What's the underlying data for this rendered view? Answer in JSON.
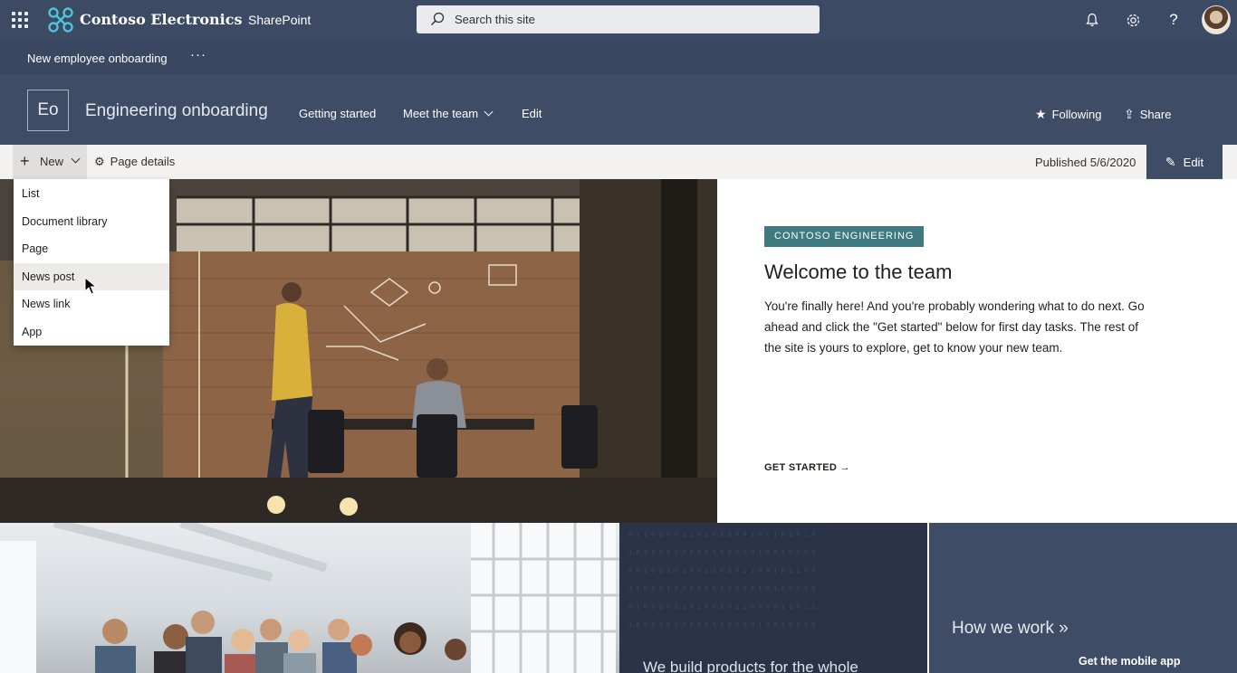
{
  "suite": {
    "brand": "Contoso Electronics",
    "product": "SharePoint",
    "search_placeholder": "Search this site"
  },
  "hub": {
    "title": "New employee onboarding",
    "more": "···"
  },
  "site": {
    "logo_initials": "Eo",
    "title": "Engineering onboarding",
    "nav": [
      {
        "label": "Getting started"
      },
      {
        "label": "Meet the team"
      },
      {
        "label": "Edit"
      }
    ],
    "following_label": "Following",
    "share_label": "Share"
  },
  "command": {
    "new_label": "New",
    "page_details_label": "Page details",
    "published": "Published 5/6/2020",
    "edit_label": "Edit"
  },
  "new_menu": {
    "items": [
      {
        "label": "List"
      },
      {
        "label": "Document library"
      },
      {
        "label": "Page"
      },
      {
        "label": "News post"
      },
      {
        "label": "News link"
      },
      {
        "label": "App"
      }
    ],
    "hovered": "News post"
  },
  "hero": {
    "tag": "CONTOSO ENGINEERING",
    "title": "Welcome to the team",
    "body": "You're finally here! And you're probably wondering what to do next. Go ahead and click the \"Get started\" below for first day tasks. The rest of the site is yours to explore, get to know your new team.",
    "cta": "GET STARTED →"
  },
  "tiles": {
    "dark_text": "We build products for the whole",
    "how_we_work": "How we work »",
    "mobile_app": "Get the mobile app"
  },
  "colors": {
    "suite_bg": "#3c4a64",
    "header_bg": "#3f4c66",
    "tag_bg": "#3f7a80",
    "command_bg": "#f3f2f1"
  }
}
